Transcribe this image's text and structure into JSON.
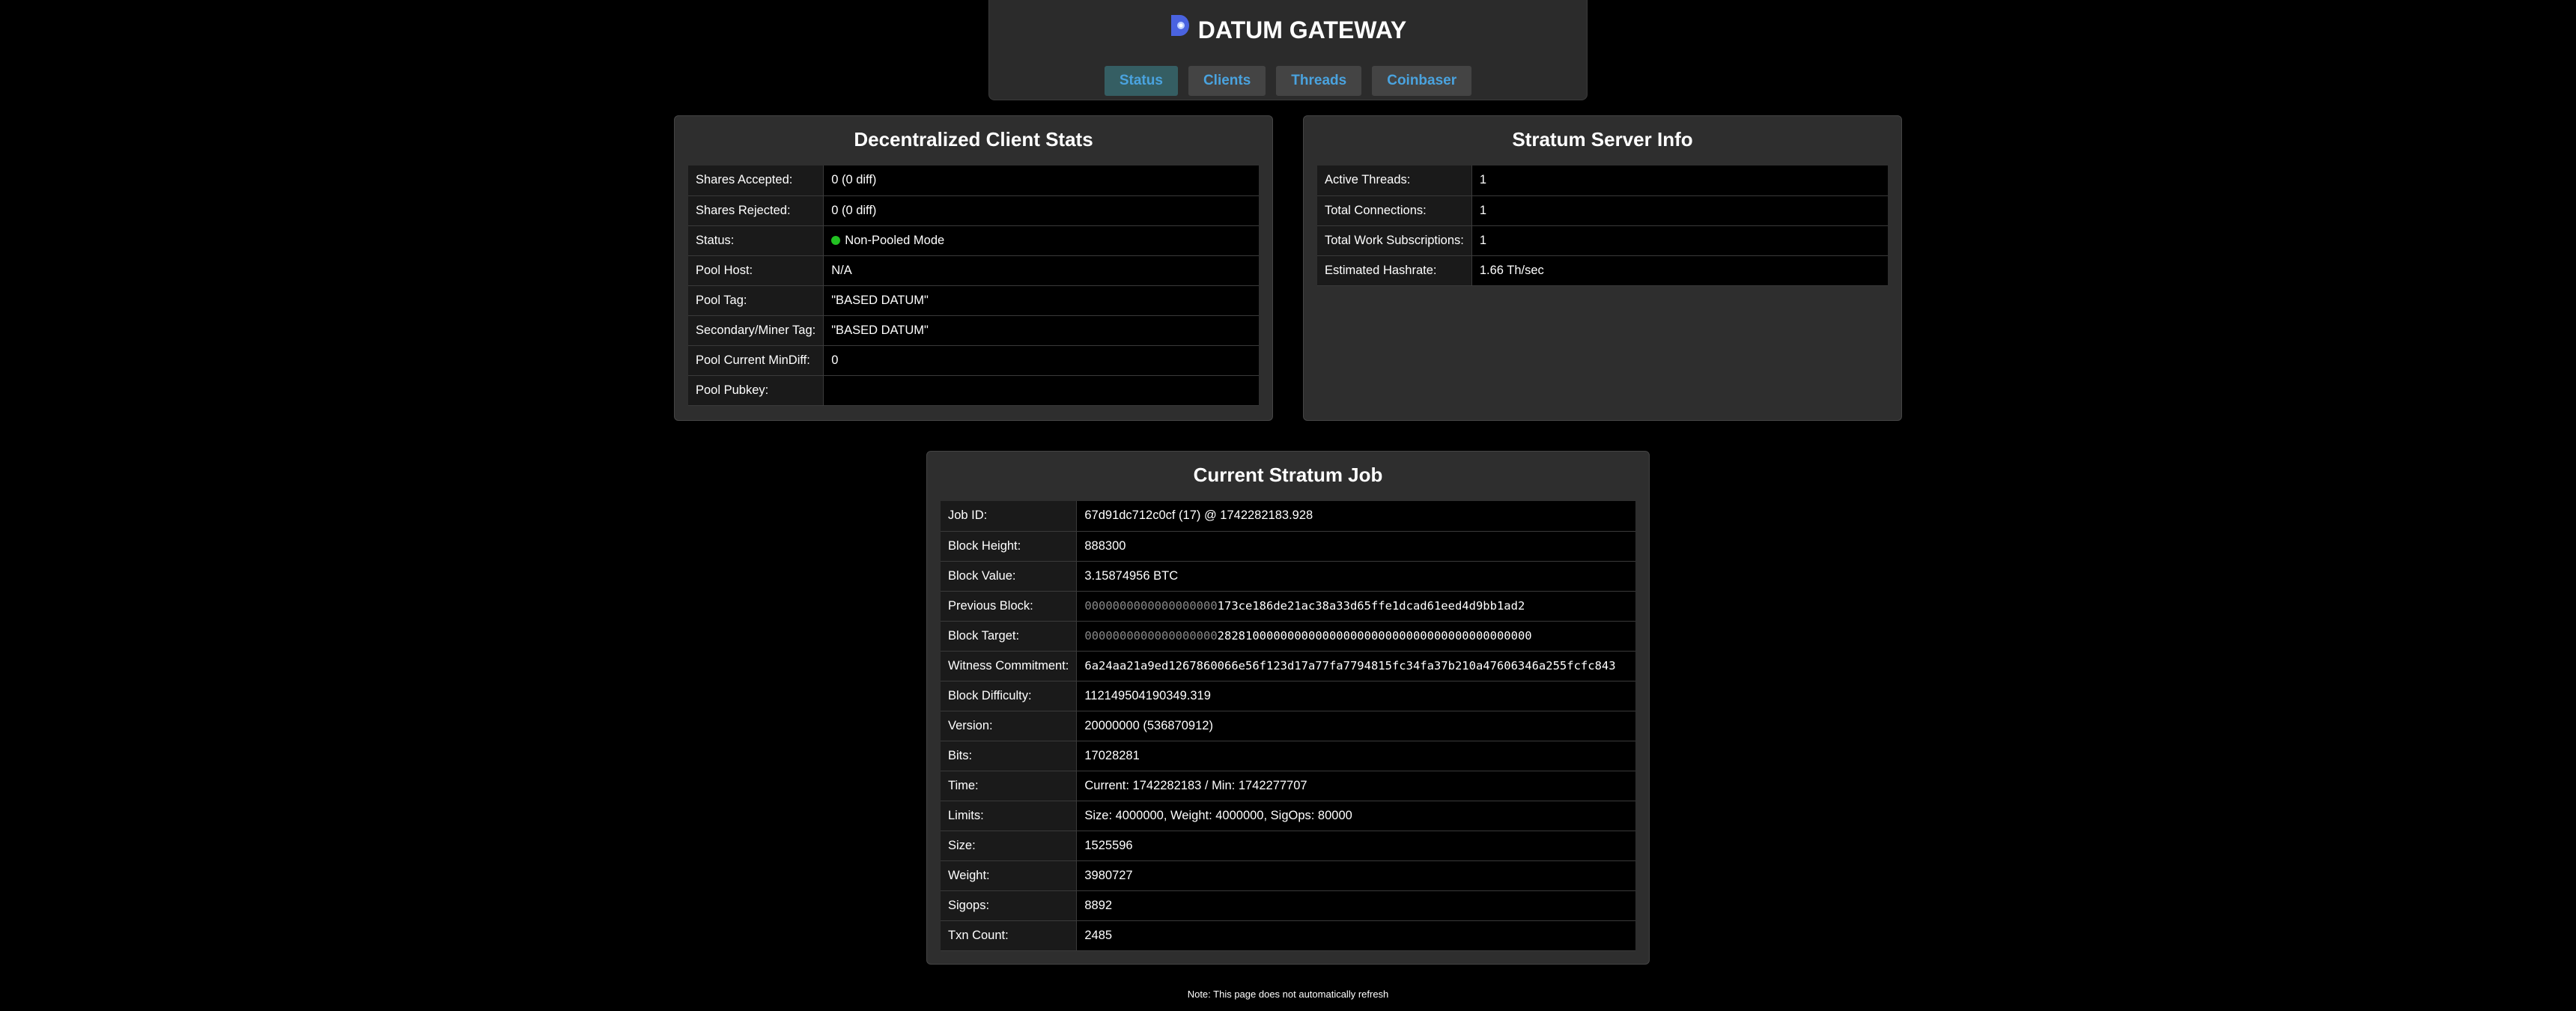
{
  "header": {
    "title": "DATUM GATEWAY",
    "logo_icon": "datum-logo-icon",
    "accent_color": "#4aa3df",
    "nav": [
      {
        "label": "Status",
        "active": true
      },
      {
        "label": "Clients",
        "active": false
      },
      {
        "label": "Threads",
        "active": false
      },
      {
        "label": "Coinbaser",
        "active": false
      }
    ]
  },
  "client_stats": {
    "title": "Decentralized Client Stats",
    "rows": [
      {
        "label": "Shares Accepted:",
        "value": "0 (0 diff)"
      },
      {
        "label": "Shares Rejected:",
        "value": "0 (0 diff)"
      },
      {
        "label": "Status:",
        "value": "Non-Pooled Mode",
        "status_color": "#22c122"
      },
      {
        "label": "Pool Host:",
        "value": "N/A"
      },
      {
        "label": "Pool Tag:",
        "value": "\"BASED DATUM\""
      },
      {
        "label": "Secondary/Miner Tag:",
        "value": "\"BASED DATUM\""
      },
      {
        "label": "Pool Current MinDiff:",
        "value": "0"
      },
      {
        "label": "Pool Pubkey:",
        "value": ""
      }
    ]
  },
  "stratum_info": {
    "title": "Stratum Server Info",
    "rows": [
      {
        "label": "Active Threads:",
        "value": "1"
      },
      {
        "label": "Total Connections:",
        "value": "1"
      },
      {
        "label": "Total Work Subscriptions:",
        "value": "1"
      },
      {
        "label": "Estimated Hashrate:",
        "value": "1.66 Th/sec"
      }
    ]
  },
  "stratum_job": {
    "title": "Current Stratum Job",
    "rows": [
      {
        "label": "Job ID:",
        "value": "67d91dc712c0cf (17) @ 1742282183.928"
      },
      {
        "label": "Block Height:",
        "value": "888300"
      },
      {
        "label": "Block Value:",
        "value": "3.15874956 BTC"
      },
      {
        "label": "Previous Block:",
        "zeros": "0000000000000000000",
        "value": "173ce186de21ac38a33d65ffe1dcad61eed4d9bb1ad2",
        "mono": true
      },
      {
        "label": "Block Target:",
        "zeros": "0000000000000000000",
        "value": "282810000000000000000000000000000000000000000",
        "mono": true
      },
      {
        "label": "Witness Commitment:",
        "value": "6a24aa21a9ed1267860066e56f123d17a77fa7794815fc34fa37b210a47606346a255fcfc843",
        "mono": true
      },
      {
        "label": "Block Difficulty:",
        "value": "112149504190349.319"
      },
      {
        "label": "Version:",
        "value": "20000000 (536870912)"
      },
      {
        "label": "Bits:",
        "value": "17028281"
      },
      {
        "label": "Time:",
        "value": "Current: 1742282183 / Min: 1742277707"
      },
      {
        "label": "Limits:",
        "value": "Size: 4000000, Weight: 4000000, SigOps: 80000"
      },
      {
        "label": "Size:",
        "value": "1525596"
      },
      {
        "label": "Weight:",
        "value": "3980727"
      },
      {
        "label": "Sigops:",
        "value": "8892"
      },
      {
        "label": "Txn Count:",
        "value": "2485"
      }
    ]
  },
  "footer": {
    "note": "Note: This page does not automatically refresh"
  }
}
